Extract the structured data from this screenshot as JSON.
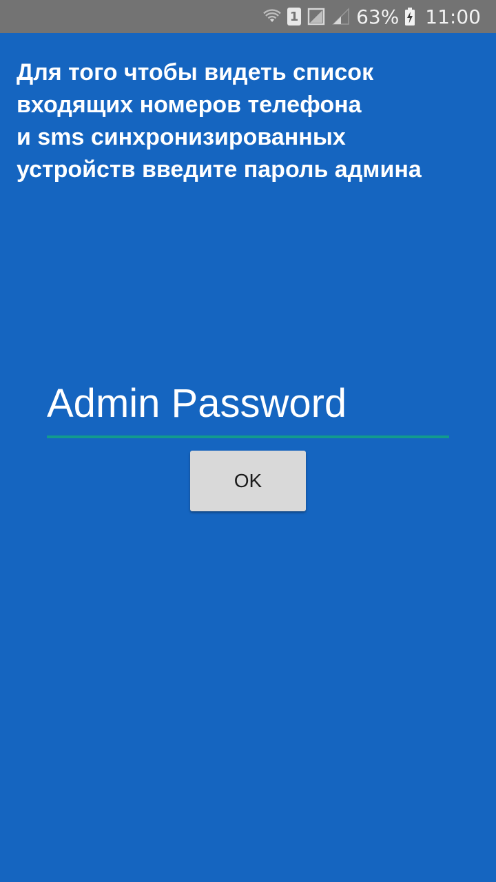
{
  "status_bar": {
    "sim_slot": "1",
    "battery_percent": "63%",
    "time": "11:00",
    "icons": [
      "wifi-icon",
      "sim-icon",
      "no-signal-icon",
      "signal-icon",
      "battery-charging-icon"
    ]
  },
  "main": {
    "intro_text": "  Для того чтобы видеть список\nвходящих номеров телефона\nи sms синхронизированных\nустройств введите пароль админа",
    "password": {
      "placeholder": "Admin Password",
      "value": ""
    },
    "ok_label": "OK"
  },
  "colors": {
    "background": "#1565c0",
    "status_bar": "#737373",
    "field_underline": "#129b8e",
    "button_bg": "#d9d9d9"
  }
}
